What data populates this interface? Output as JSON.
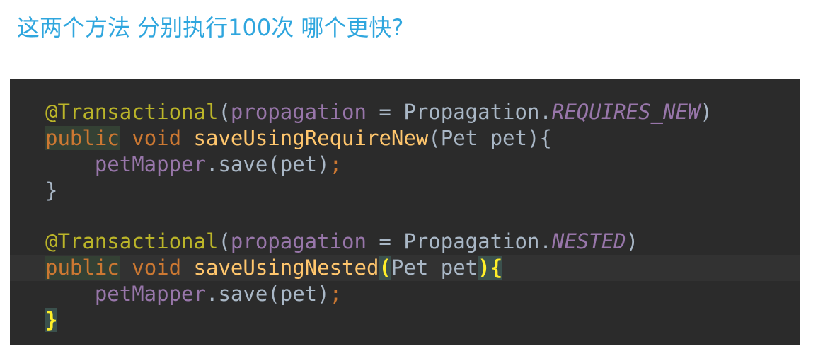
{
  "question": "这两个方法 分别执行100次 哪个更快?",
  "code": {
    "method1": {
      "annotation": "@Transactional",
      "param_name": "propagation",
      "equals": " = ",
      "propagation_class": "Propagation.",
      "propagation_value": "REQUIRES_NEW",
      "modifier": "public",
      "return_type": "void",
      "method_name": "saveUsingRequireNew",
      "params": "Pet pet",
      "body_target": "petMapper",
      "body_call": ".save(pet)",
      "close_brace": "}"
    },
    "method2": {
      "annotation": "@Transactional",
      "param_name": "propagation",
      "equals": " = ",
      "propagation_class": "Propagation.",
      "propagation_value": "NESTED",
      "modifier": "public",
      "return_type": "void",
      "method_name": "saveUsingNested",
      "params": "Pet pet",
      "body_target": "petMapper",
      "body_call": ".save(pet)",
      "close_brace": "}"
    },
    "colors": {
      "background": "#2b2b2b",
      "annotation": "#bbb529",
      "keyword": "#cc7832",
      "method": "#ffc66d",
      "field": "#9876aa",
      "text": "#a9b7c6",
      "brace_match": "#ffef28",
      "question": "#2fa6de"
    }
  }
}
